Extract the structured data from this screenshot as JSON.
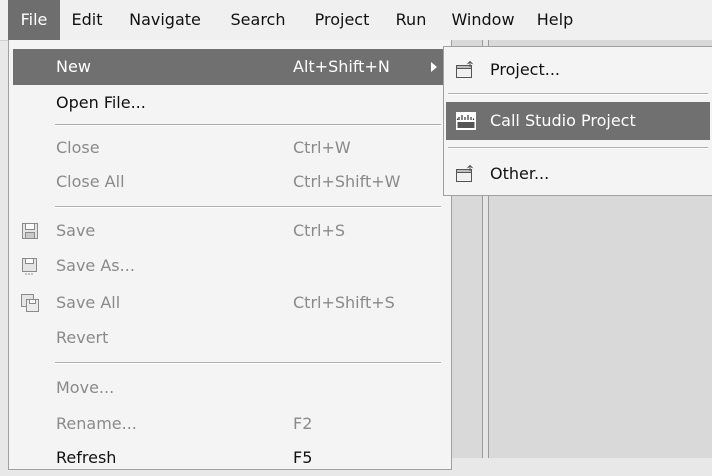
{
  "menubar": {
    "items": [
      "File",
      "Edit",
      "Navigate",
      "Search",
      "Project",
      "Run",
      "Window",
      "Help"
    ],
    "active": "File"
  },
  "file_menu": {
    "new": {
      "label": "New",
      "shortcut": "Alt+Shift+N"
    },
    "open_file": {
      "label": "Open File..."
    },
    "close": {
      "label": "Close",
      "shortcut": "Ctrl+W"
    },
    "close_all": {
      "label": "Close All",
      "shortcut": "Ctrl+Shift+W"
    },
    "save": {
      "label": "Save",
      "shortcut": "Ctrl+S",
      "icon": "save-icon"
    },
    "save_as": {
      "label": "Save As...",
      "icon": "save-as-icon"
    },
    "save_all": {
      "label": "Save All",
      "shortcut": "Ctrl+Shift+S",
      "icon": "save-all-icon"
    },
    "revert": {
      "label": "Revert"
    },
    "move": {
      "label": "Move..."
    },
    "rename": {
      "label": "Rename...",
      "shortcut": "F2"
    },
    "refresh": {
      "label": "Refresh",
      "shortcut": "F5"
    }
  },
  "new_submenu": {
    "project": {
      "label": "Project...",
      "icon": "new-project-icon"
    },
    "call_studio": {
      "label": "Call Studio Project",
      "icon": "cisco-logo-icon"
    },
    "other": {
      "label": "Other...",
      "icon": "new-wizard-icon"
    }
  },
  "colors": {
    "highlight": "#707070",
    "disabled_text": "#8a8a8a",
    "menu_bg": "#f4f4f4"
  }
}
